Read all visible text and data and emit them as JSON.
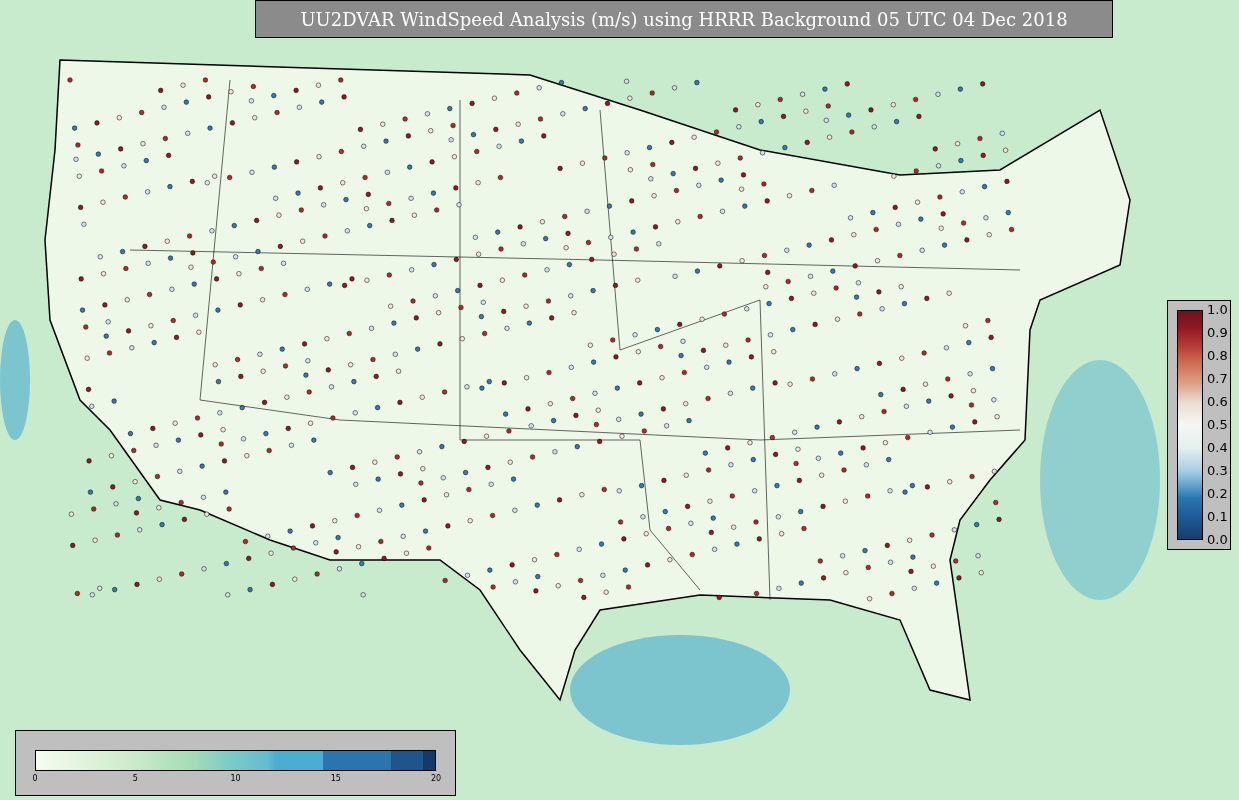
{
  "title": "UU2DVAR WindSpeed Analysis (m/s) using HRRR Background 05 UTC 04 Dec 2018",
  "station_colorbar": {
    "ticks": [
      "1.0",
      "0.9",
      "0.8",
      "0.7",
      "0.6",
      "0.5",
      "0.4",
      "0.3",
      "0.2",
      "0.1",
      "0.0"
    ]
  },
  "wind_colorbar": {
    "ticks": [
      "0",
      "5",
      "10",
      "15",
      "20"
    ]
  }
}
